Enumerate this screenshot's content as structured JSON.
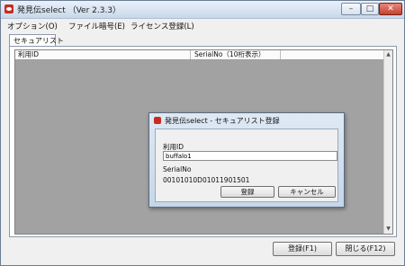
{
  "window": {
    "title": "発見伝select （Ver 2.3.3）",
    "controls": {
      "minimize": "–",
      "maximize": "□",
      "close": "✕"
    }
  },
  "menu": [
    "オプション(O)",
    "ファイル暗号(E)",
    "ライセンス登録(L)"
  ],
  "tabs": [
    {
      "label": "セキュアリスト",
      "selected": true
    }
  ],
  "grid": {
    "columns": [
      "利用ID",
      "SerialNo（10桁表示）"
    ],
    "rows": []
  },
  "footer": {
    "register_label": "登録(F1)",
    "close_label": "閉じる(F12)"
  },
  "dialog": {
    "title": "発見伝select - セキュアリスト登録",
    "userid_label": "利用ID",
    "userid_value": "buffalo1",
    "serial_label": "SerialNo",
    "serial_value": "00101010D01011901501",
    "register_label": "登録",
    "cancel_label": "キャンセル"
  },
  "colors": {
    "accent": "#c82b1e",
    "titlebar": "#c8d8ea",
    "grid_bg": "#a2a2a2"
  },
  "icons": {
    "app": "app-logo-icon",
    "scroll_up": "scroll-up-icon",
    "scroll_down": "scroll-down-icon"
  }
}
